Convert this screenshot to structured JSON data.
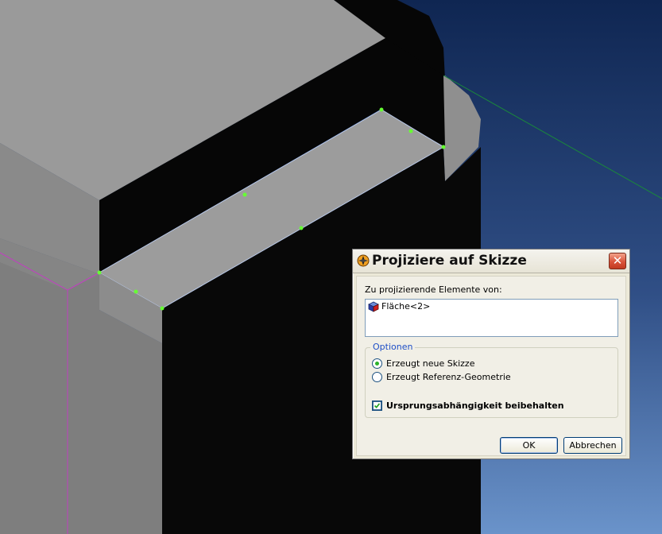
{
  "dialog": {
    "title": "Projiziere auf Skizze",
    "close_glyph": "✕",
    "elements_label": "Zu projizierende Elemente von:",
    "elements": [
      {
        "label": "Fläche<2>",
        "icon": "face-icon"
      }
    ],
    "options": {
      "legend": "Optionen",
      "radios": [
        {
          "label": "Erzeugt neue Skizze",
          "selected": true
        },
        {
          "label": "Erzeugt Referenz-Geometrie",
          "selected": false
        }
      ],
      "checkbox": {
        "label": "Ursprungsabhängigkeit beibehalten",
        "checked": true
      }
    },
    "buttons": {
      "ok": "OK",
      "cancel": "Abbrechen"
    }
  },
  "colors": {
    "viewport_bg_top": "#122a5a",
    "viewport_bg_bottom": "#6189c4",
    "model_dark": "#060606",
    "model_light": "#9a9a9a",
    "model_mid": "#8a8a8a",
    "sketch_point": "#66ff33",
    "axis_magenta": "#c040c0",
    "axis_green": "#1a8a3a",
    "close_red": "#d9533a"
  }
}
